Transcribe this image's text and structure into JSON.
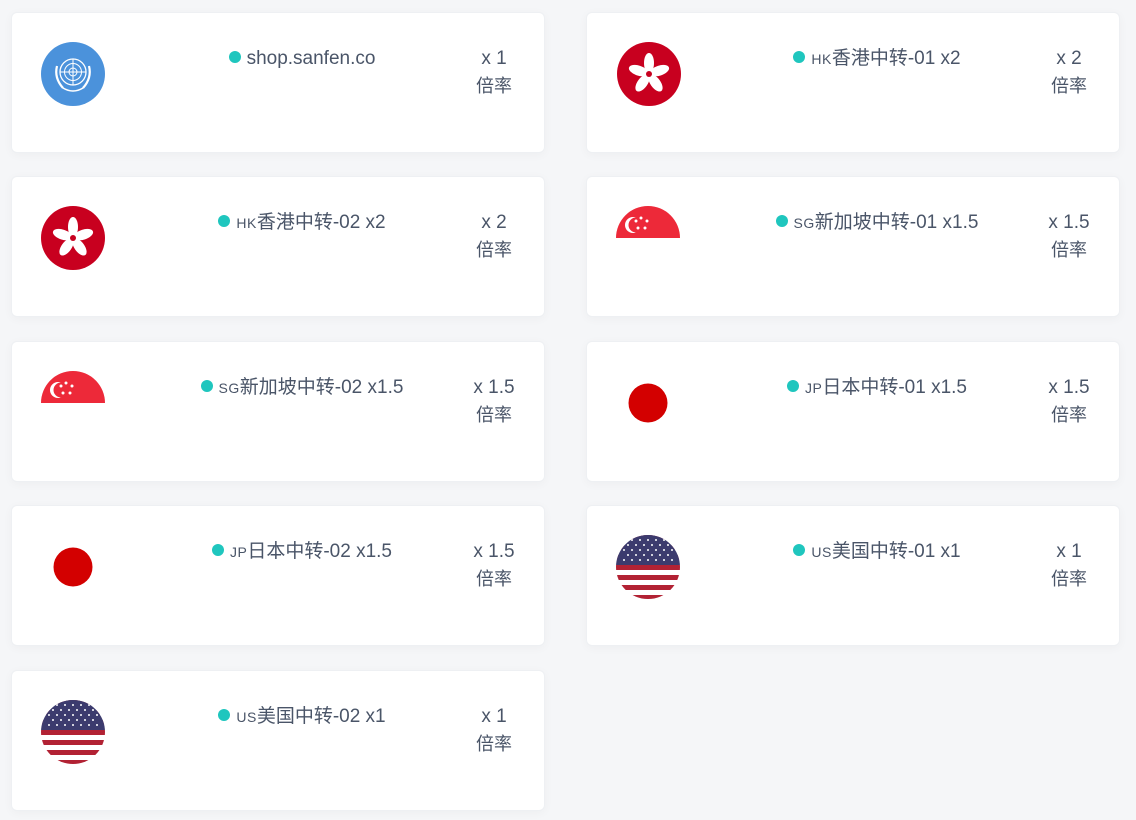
{
  "rate_label": "倍率",
  "status_color": "#1fc6be",
  "nodes": [
    {
      "flag": "un-flag-icon",
      "prefix": "",
      "title": "shop.sanfen.co",
      "rate": "x 1"
    },
    {
      "flag": "hong-kong-flag-icon",
      "prefix": "HK",
      "title": "香港中转-01 x2",
      "rate": "x 2"
    },
    {
      "flag": "hong-kong-flag-icon",
      "prefix": "HK",
      "title": "香港中转-02 x2",
      "rate": "x 2"
    },
    {
      "flag": "singapore-flag-icon",
      "prefix": "SG",
      "title": "新加坡中转-01 x1.5",
      "rate": "x 1.5"
    },
    {
      "flag": "singapore-flag-icon",
      "prefix": "SG",
      "title": "新加坡中转-02 x1.5",
      "rate": "x 1.5"
    },
    {
      "flag": "japan-flag-icon",
      "prefix": "JP",
      "title": "日本中转-01 x1.5",
      "rate": "x 1.5"
    },
    {
      "flag": "japan-flag-icon",
      "prefix": "JP",
      "title": "日本中转-02 x1.5",
      "rate": "x 1.5"
    },
    {
      "flag": "usa-flag-icon",
      "prefix": "US",
      "title": "美国中转-01 x1",
      "rate": "x 1"
    },
    {
      "flag": "usa-flag-icon",
      "prefix": "US",
      "title": "美国中转-02 x1",
      "rate": "x 1"
    }
  ]
}
